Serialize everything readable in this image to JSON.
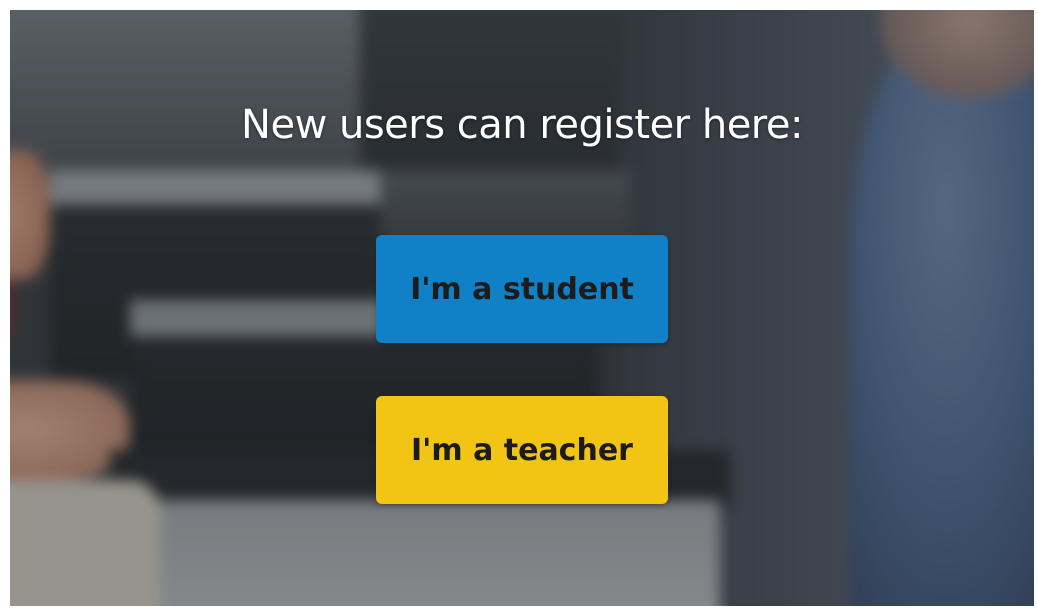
{
  "heading": "New users can register here:",
  "buttons": {
    "student_label": "I'm a student",
    "teacher_label": "I'm a teacher"
  },
  "colors": {
    "student_button": "#1081c6",
    "teacher_button": "#f2c414",
    "heading_text": "#ffffff"
  }
}
